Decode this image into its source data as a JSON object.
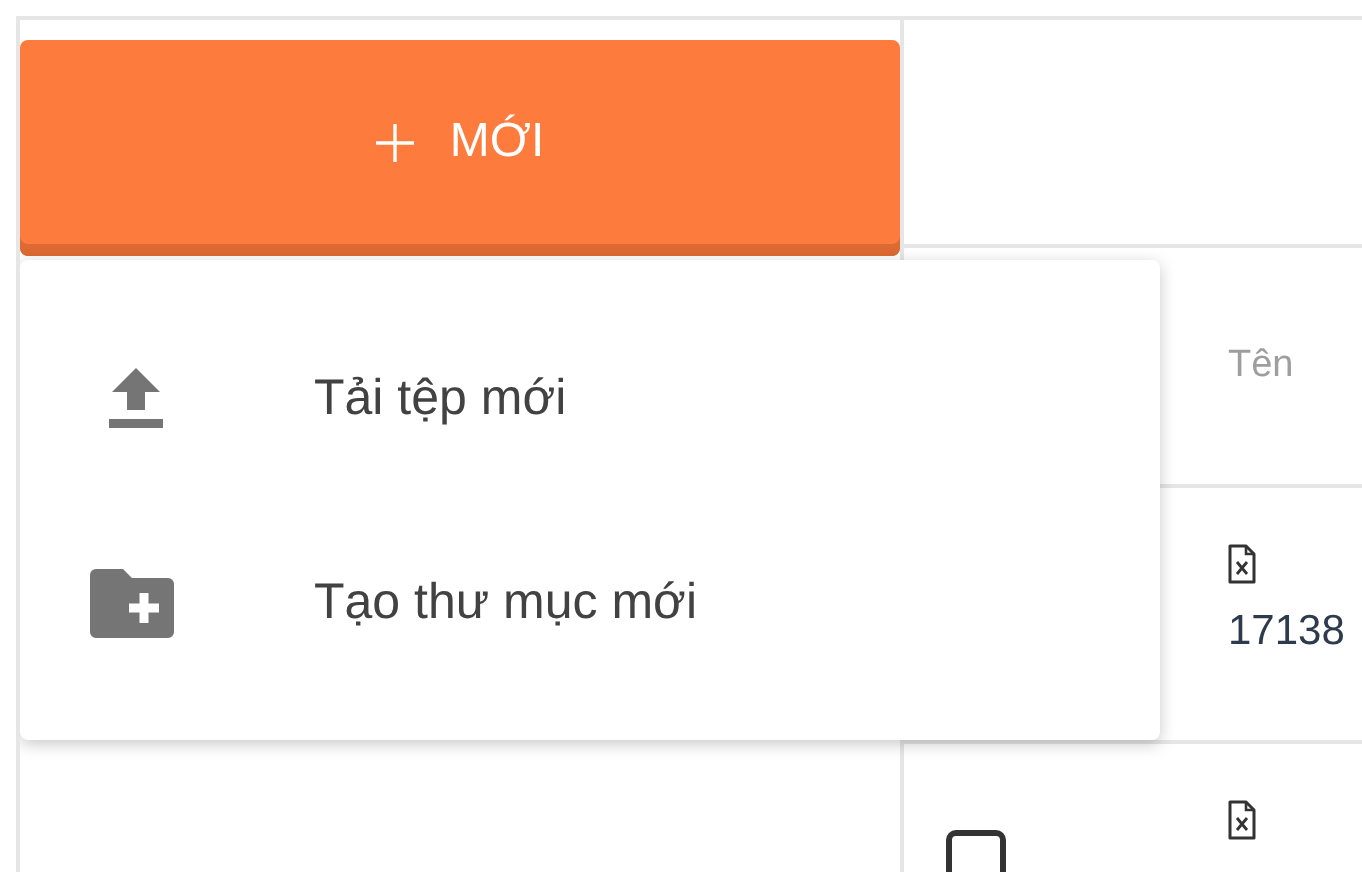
{
  "new_button": {
    "label": "MỚI"
  },
  "new_menu": {
    "items": [
      {
        "kind": "upload",
        "label": "Tải tệp mới"
      },
      {
        "kind": "new-folder",
        "label": "Tạo thư mục mới"
      }
    ]
  },
  "file_table": {
    "columns": [
      "Tên"
    ],
    "rows": [
      {
        "name": "17138"
      },
      {
        "checked": false
      }
    ]
  }
}
